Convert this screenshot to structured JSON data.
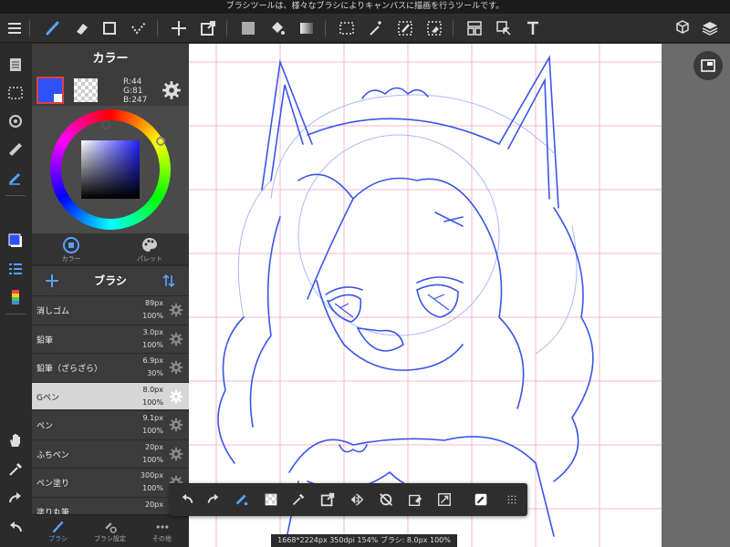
{
  "hint_bar": {
    "text": "ブラシツールは、様々なブラシによりキャンバスに描画を行うツールです。"
  },
  "toolbar": {
    "icons": [
      "menu-icon",
      "brush-icon",
      "eraser-icon",
      "shape-icon",
      "dot-icon",
      "move-icon",
      "transform-icon",
      "fill-color-icon",
      "bucket-icon",
      "gradient-icon",
      "selection-icon",
      "magic-wand-icon",
      "select-pen-icon",
      "select-eraser-icon",
      "layout-icon",
      "operation-icon",
      "text-icon",
      "3d-icon",
      "layers-icon"
    ]
  },
  "color_panel": {
    "title": "カラー",
    "main_color": "#2c51f7",
    "r_label": "R:44",
    "g_label": "G:81",
    "b_label": "B:247",
    "tabs": [
      {
        "label": "カラー"
      },
      {
        "label": "パレット"
      }
    ]
  },
  "brush_panel": {
    "title": "ブラシ",
    "brushes": [
      {
        "name": "消しゴム",
        "size": "89px",
        "opacity": "100%"
      },
      {
        "name": "鉛筆",
        "size": "3.0px",
        "opacity": "100%"
      },
      {
        "name": "鉛筆（ざらざら）",
        "size": "6.9px",
        "opacity": "30%"
      },
      {
        "name": "Gペン",
        "size": "8.0px",
        "opacity": "100%"
      },
      {
        "name": "ペン",
        "size": "9.1px",
        "opacity": "100%"
      },
      {
        "name": "ふちペン",
        "size": "20px",
        "opacity": "100%"
      },
      {
        "name": "ペン塗り",
        "size": "300px",
        "opacity": "100%"
      },
      {
        "name": "塗り丸筆",
        "size": "20px",
        "opacity": ""
      }
    ],
    "selected_index": 3,
    "footer_tabs": [
      {
        "label": "ブラシ"
      },
      {
        "label": "ブラシ設定"
      },
      {
        "label": "その他"
      }
    ]
  },
  "status_bar": {
    "text": "1668*2224px 350dpi 154% ブラシ: 8.0px 100%"
  },
  "colors": {
    "accent": "#2c51f7",
    "sketch": "#3a55e8",
    "grid": "#f0b8c8"
  }
}
